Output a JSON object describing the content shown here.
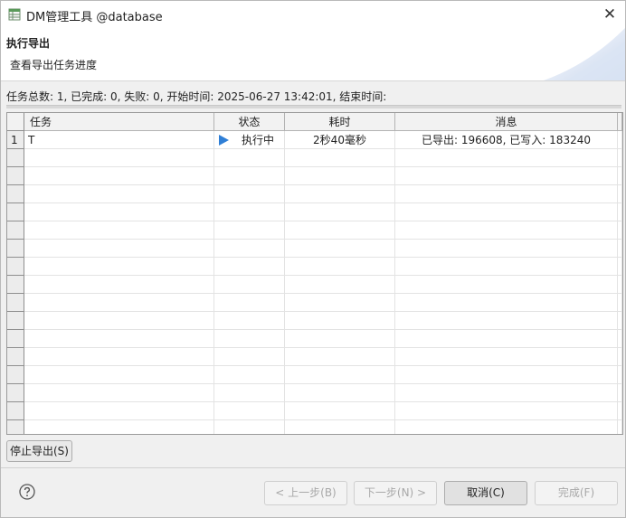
{
  "window": {
    "title": "DM管理工具 @database",
    "close_glyph": "✕"
  },
  "header": {
    "title": "执行导出",
    "subtitle": "查看导出任务进度"
  },
  "summary": "任务总数: 1, 已完成: 0, 失败: 0, 开始时间: 2025-06-27 13:42:01, 结束时间:",
  "table": {
    "columns": [
      "任务",
      "状态",
      "耗时",
      "消息"
    ],
    "rows": [
      {
        "index": "1",
        "task": "T",
        "status": "执行中",
        "status_icon": "play-icon",
        "duration": "2秒40毫秒",
        "message": "已导出: 196608, 已写入: 183240"
      }
    ]
  },
  "buttons": {
    "stop": "停止导出(S)",
    "back": "< 上一步(B)",
    "next": "下一步(N) >",
    "cancel": "取消(C)",
    "finish": "完成(F)"
  },
  "icons": {
    "app": "table-app-icon",
    "help": "help-icon",
    "close": "close-icon"
  },
  "colors": {
    "play_icon": "#2f7fd6",
    "grid_border": "#9a9a9a",
    "disabled_text": "#a8a8a8"
  }
}
